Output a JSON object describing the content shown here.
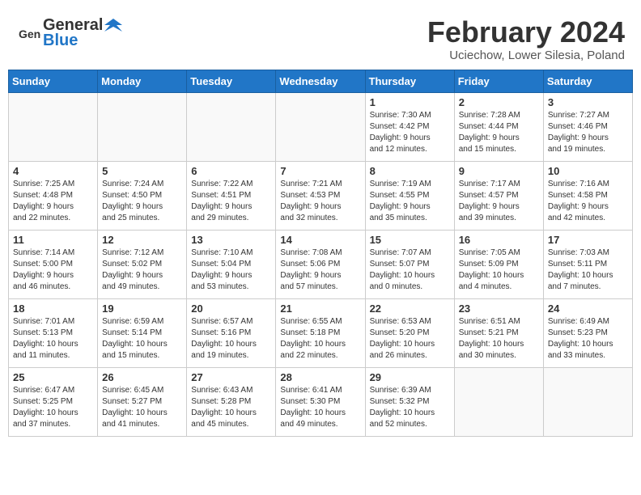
{
  "header": {
    "logo_general": "General",
    "logo_blue": "Blue",
    "month_year": "February 2024",
    "location": "Uciechow, Lower Silesia, Poland"
  },
  "weekdays": [
    "Sunday",
    "Monday",
    "Tuesday",
    "Wednesday",
    "Thursday",
    "Friday",
    "Saturday"
  ],
  "weeks": [
    [
      {
        "day": "",
        "info": ""
      },
      {
        "day": "",
        "info": ""
      },
      {
        "day": "",
        "info": ""
      },
      {
        "day": "",
        "info": ""
      },
      {
        "day": "1",
        "info": "Sunrise: 7:30 AM\nSunset: 4:42 PM\nDaylight: 9 hours\nand 12 minutes."
      },
      {
        "day": "2",
        "info": "Sunrise: 7:28 AM\nSunset: 4:44 PM\nDaylight: 9 hours\nand 15 minutes."
      },
      {
        "day": "3",
        "info": "Sunrise: 7:27 AM\nSunset: 4:46 PM\nDaylight: 9 hours\nand 19 minutes."
      }
    ],
    [
      {
        "day": "4",
        "info": "Sunrise: 7:25 AM\nSunset: 4:48 PM\nDaylight: 9 hours\nand 22 minutes."
      },
      {
        "day": "5",
        "info": "Sunrise: 7:24 AM\nSunset: 4:50 PM\nDaylight: 9 hours\nand 25 minutes."
      },
      {
        "day": "6",
        "info": "Sunrise: 7:22 AM\nSunset: 4:51 PM\nDaylight: 9 hours\nand 29 minutes."
      },
      {
        "day": "7",
        "info": "Sunrise: 7:21 AM\nSunset: 4:53 PM\nDaylight: 9 hours\nand 32 minutes."
      },
      {
        "day": "8",
        "info": "Sunrise: 7:19 AM\nSunset: 4:55 PM\nDaylight: 9 hours\nand 35 minutes."
      },
      {
        "day": "9",
        "info": "Sunrise: 7:17 AM\nSunset: 4:57 PM\nDaylight: 9 hours\nand 39 minutes."
      },
      {
        "day": "10",
        "info": "Sunrise: 7:16 AM\nSunset: 4:58 PM\nDaylight: 9 hours\nand 42 minutes."
      }
    ],
    [
      {
        "day": "11",
        "info": "Sunrise: 7:14 AM\nSunset: 5:00 PM\nDaylight: 9 hours\nand 46 minutes."
      },
      {
        "day": "12",
        "info": "Sunrise: 7:12 AM\nSunset: 5:02 PM\nDaylight: 9 hours\nand 49 minutes."
      },
      {
        "day": "13",
        "info": "Sunrise: 7:10 AM\nSunset: 5:04 PM\nDaylight: 9 hours\nand 53 minutes."
      },
      {
        "day": "14",
        "info": "Sunrise: 7:08 AM\nSunset: 5:06 PM\nDaylight: 9 hours\nand 57 minutes."
      },
      {
        "day": "15",
        "info": "Sunrise: 7:07 AM\nSunset: 5:07 PM\nDaylight: 10 hours\nand 0 minutes."
      },
      {
        "day": "16",
        "info": "Sunrise: 7:05 AM\nSunset: 5:09 PM\nDaylight: 10 hours\nand 4 minutes."
      },
      {
        "day": "17",
        "info": "Sunrise: 7:03 AM\nSunset: 5:11 PM\nDaylight: 10 hours\nand 7 minutes."
      }
    ],
    [
      {
        "day": "18",
        "info": "Sunrise: 7:01 AM\nSunset: 5:13 PM\nDaylight: 10 hours\nand 11 minutes."
      },
      {
        "day": "19",
        "info": "Sunrise: 6:59 AM\nSunset: 5:14 PM\nDaylight: 10 hours\nand 15 minutes."
      },
      {
        "day": "20",
        "info": "Sunrise: 6:57 AM\nSunset: 5:16 PM\nDaylight: 10 hours\nand 19 minutes."
      },
      {
        "day": "21",
        "info": "Sunrise: 6:55 AM\nSunset: 5:18 PM\nDaylight: 10 hours\nand 22 minutes."
      },
      {
        "day": "22",
        "info": "Sunrise: 6:53 AM\nSunset: 5:20 PM\nDaylight: 10 hours\nand 26 minutes."
      },
      {
        "day": "23",
        "info": "Sunrise: 6:51 AM\nSunset: 5:21 PM\nDaylight: 10 hours\nand 30 minutes."
      },
      {
        "day": "24",
        "info": "Sunrise: 6:49 AM\nSunset: 5:23 PM\nDaylight: 10 hours\nand 33 minutes."
      }
    ],
    [
      {
        "day": "25",
        "info": "Sunrise: 6:47 AM\nSunset: 5:25 PM\nDaylight: 10 hours\nand 37 minutes."
      },
      {
        "day": "26",
        "info": "Sunrise: 6:45 AM\nSunset: 5:27 PM\nDaylight: 10 hours\nand 41 minutes."
      },
      {
        "day": "27",
        "info": "Sunrise: 6:43 AM\nSunset: 5:28 PM\nDaylight: 10 hours\nand 45 minutes."
      },
      {
        "day": "28",
        "info": "Sunrise: 6:41 AM\nSunset: 5:30 PM\nDaylight: 10 hours\nand 49 minutes."
      },
      {
        "day": "29",
        "info": "Sunrise: 6:39 AM\nSunset: 5:32 PM\nDaylight: 10 hours\nand 52 minutes."
      },
      {
        "day": "",
        "info": ""
      },
      {
        "day": "",
        "info": ""
      }
    ]
  ]
}
